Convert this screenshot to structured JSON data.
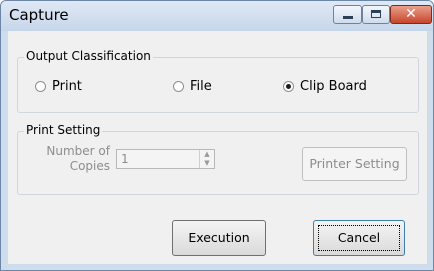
{
  "window": {
    "title": "Capture",
    "close_glyph": "✕"
  },
  "output_classification": {
    "legend": "Output Classification",
    "options": [
      {
        "label": "Print",
        "selected": false
      },
      {
        "label": "File",
        "selected": false
      },
      {
        "label": "Clip Board",
        "selected": true
      }
    ]
  },
  "print_setting": {
    "legend": "Print Setting",
    "copies_label_line1": "Number of",
    "copies_label_line2": "Copies",
    "copies_value": "1",
    "printer_setting_label": "Printer Setting"
  },
  "actions": {
    "execution_label": "Execution",
    "cancel_label": "Cancel"
  }
}
